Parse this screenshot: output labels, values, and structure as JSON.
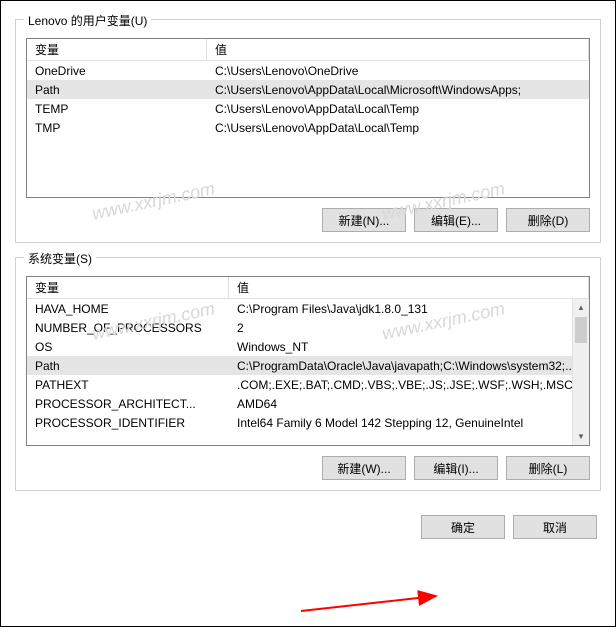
{
  "user_section": {
    "title": "Lenovo 的用户变量(U)",
    "headers": {
      "name": "变量",
      "value": "值"
    },
    "rows": [
      {
        "name": "OneDrive",
        "value": "C:\\Users\\Lenovo\\OneDrive",
        "selected": false
      },
      {
        "name": "Path",
        "value": "C:\\Users\\Lenovo\\AppData\\Local\\Microsoft\\WindowsApps;",
        "selected": true
      },
      {
        "name": "TEMP",
        "value": "C:\\Users\\Lenovo\\AppData\\Local\\Temp",
        "selected": false
      },
      {
        "name": "TMP",
        "value": "C:\\Users\\Lenovo\\AppData\\Local\\Temp",
        "selected": false
      }
    ],
    "buttons": {
      "new": "新建(N)...",
      "edit": "编辑(E)...",
      "delete": "删除(D)"
    }
  },
  "system_section": {
    "title": "系统变量(S)",
    "headers": {
      "name": "变量",
      "value": "值"
    },
    "rows": [
      {
        "name": "HAVA_HOME",
        "value": "C:\\Program Files\\Java\\jdk1.8.0_131",
        "selected": false
      },
      {
        "name": "NUMBER_OF_PROCESSORS",
        "value": "2",
        "selected": false
      },
      {
        "name": "OS",
        "value": "Windows_NT",
        "selected": false
      },
      {
        "name": "Path",
        "value": "C:\\ProgramData\\Oracle\\Java\\javapath;C:\\Windows\\system32;...",
        "selected": true
      },
      {
        "name": "PATHEXT",
        "value": ".COM;.EXE;.BAT;.CMD;.VBS;.VBE;.JS;.JSE;.WSF;.WSH;.MSC",
        "selected": false
      },
      {
        "name": "PROCESSOR_ARCHITECT...",
        "value": "AMD64",
        "selected": false
      },
      {
        "name": "PROCESSOR_IDENTIFIER",
        "value": "Intel64 Family 6 Model 142 Stepping 12, GenuineIntel",
        "selected": false
      }
    ],
    "buttons": {
      "new": "新建(W)...",
      "edit": "编辑(I)...",
      "delete": "删除(L)"
    }
  },
  "dialog": {
    "ok": "确定",
    "cancel": "取消"
  },
  "watermarks": [
    "www.xxrjm.com",
    "www.xxrjm.com",
    "www.xxrjm.com",
    "www.xxrjm.com"
  ]
}
